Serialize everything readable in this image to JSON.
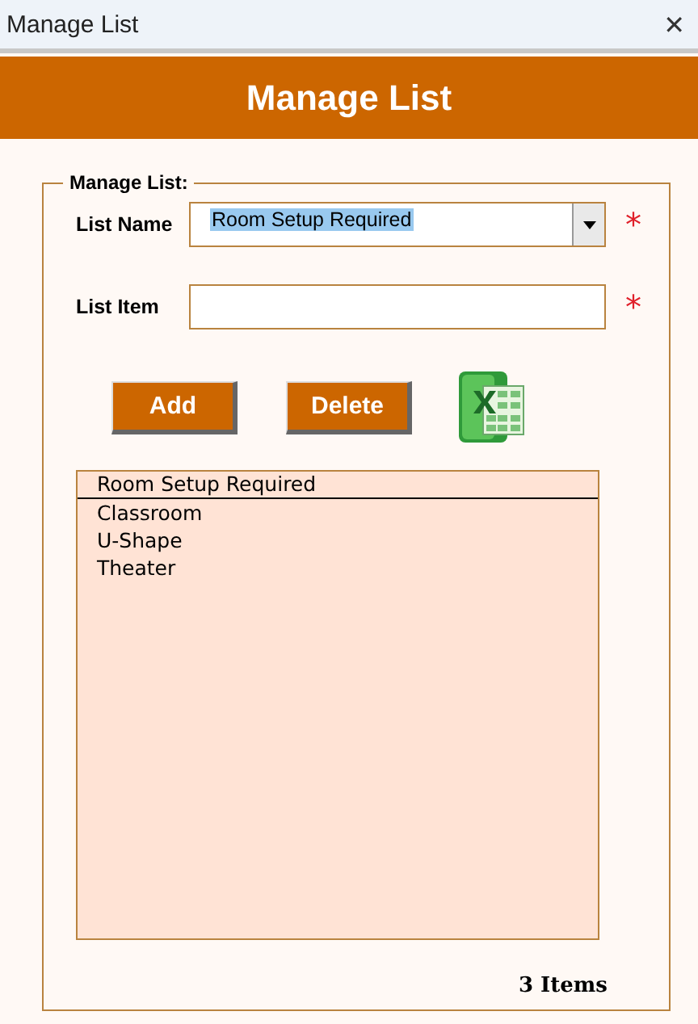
{
  "window": {
    "title": "Manage List",
    "close": "✕"
  },
  "header": {
    "title": "Manage List"
  },
  "group": {
    "legend": "Manage List:"
  },
  "fields": [
    {
      "label": "List Name",
      "kind": "dropdown",
      "value": "Room Setup Required",
      "text_selected": true,
      "required": true,
      "required_mark": "*"
    },
    {
      "label": "List Item",
      "kind": "text",
      "required": true,
      "required_mark": "*"
    }
  ],
  "buttons": [
    "Add",
    "Delete"
  ],
  "list": {
    "header": "Room Setup Required",
    "items": [
      "Classroom",
      "U-Shape",
      "Theater"
    ]
  },
  "count": "3 Items"
}
